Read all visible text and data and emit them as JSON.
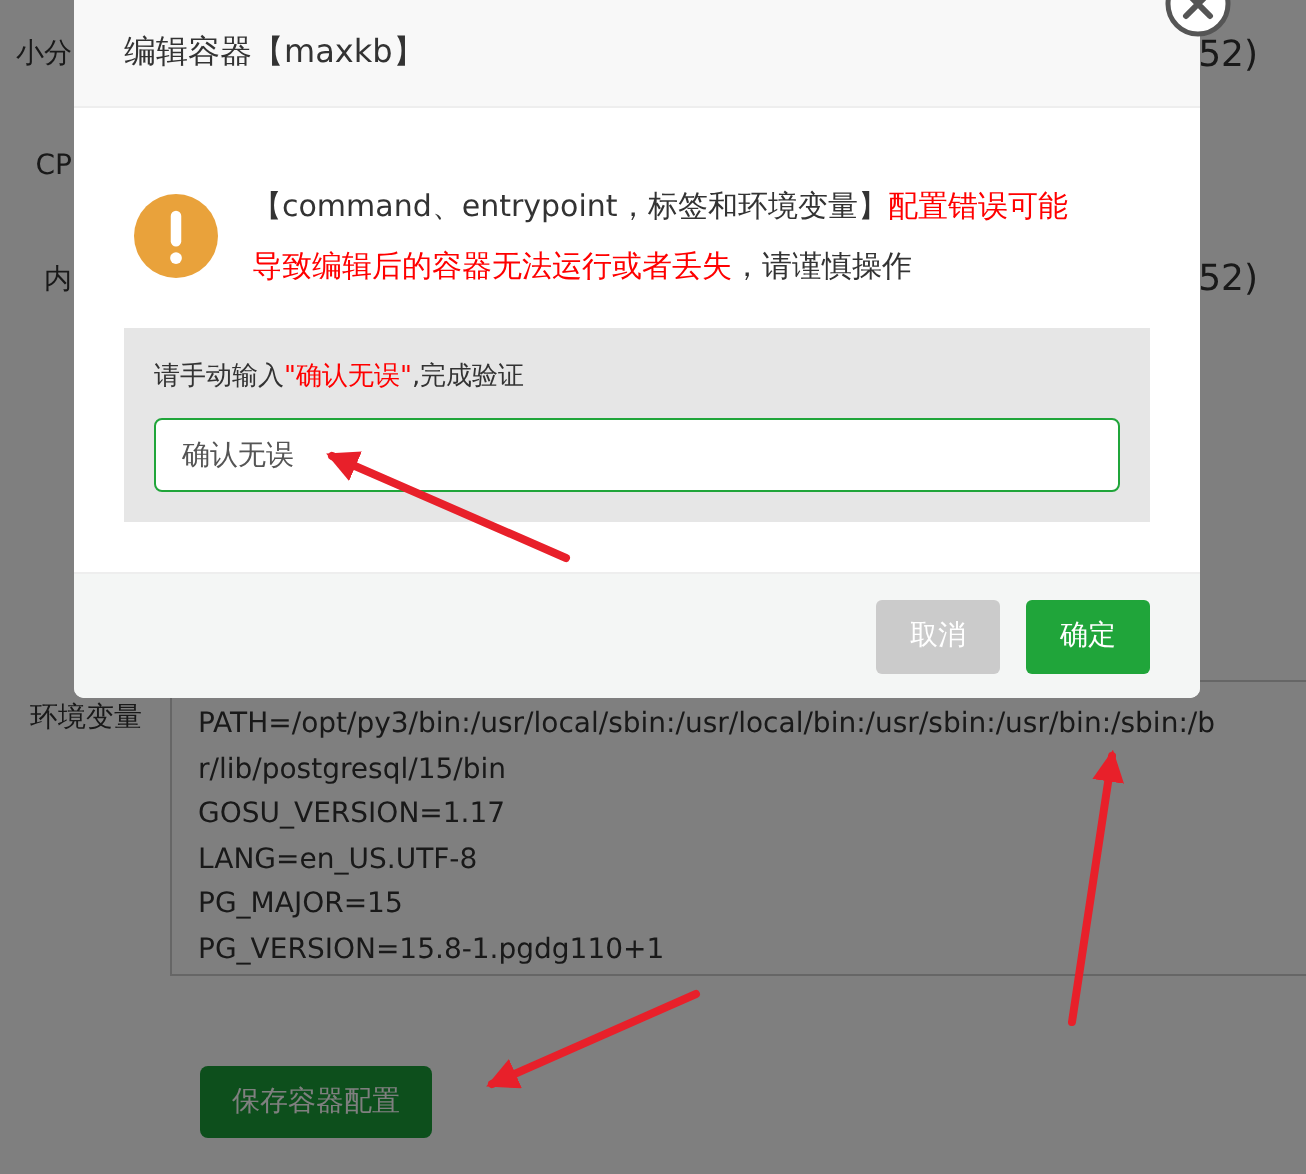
{
  "background_form": {
    "rows": [
      {
        "label": "小分",
        "value": "52)"
      },
      {
        "label": "CP"
      },
      {
        "label": "内",
        "value": "52)"
      }
    ],
    "env_label": "环境变量",
    "env_lines": [
      "PATH=/opt/py3/bin:/usr/local/sbin:/usr/local/bin:/usr/sbin:/usr/bin:/sbin:/b",
      "r/lib/postgresql/15/bin",
      "GOSU_VERSION=1.17",
      "LANG=en_US.UTF-8",
      "PG_MAJOR=15",
      "PG_VERSION=15.8-1.pgdg110+1"
    ],
    "save_button": "保存容器配置"
  },
  "dialog": {
    "title": "编辑容器【maxkb】",
    "warning_parts": [
      {
        "text": "【command、entrypoint，标签和环境变量】",
        "emphasis": false
      },
      {
        "text": "配置错误可能导致编辑后的容器无法运行或者丢失",
        "emphasis": true
      },
      {
        "text": "，请谨慎操作",
        "emphasis": false
      }
    ],
    "prompt_parts": [
      {
        "text": "请手动输入",
        "emphasis": false
      },
      {
        "text": "\"确认无误\"",
        "emphasis": true
      },
      {
        "text": ",完成验证",
        "emphasis": false
      }
    ],
    "input": {
      "value": "确认无误",
      "focused": true
    },
    "buttons": [
      {
        "label": "取消",
        "kind": "cancel"
      },
      {
        "label": "确定",
        "kind": "confirm"
      }
    ]
  }
}
